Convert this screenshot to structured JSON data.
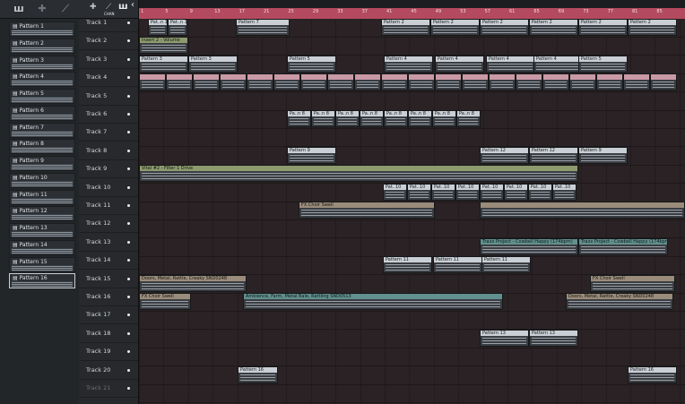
{
  "picker": {
    "icons": [
      "piano-roll-icon",
      "add-icon",
      "wand-icon"
    ],
    "patterns": [
      "Pattern 1",
      "Pattern 2",
      "Pattern 3",
      "Pattern 4",
      "Pattern 5",
      "Pattern 6",
      "Pattern 7",
      "Pattern 8",
      "Pattern 9",
      "Pattern 10",
      "Pattern 11",
      "Pattern 12",
      "Pattern 13",
      "Pattern 14",
      "Pattern 15",
      "Pattern 16"
    ],
    "selected": "Pattern 16"
  },
  "toolbar": {
    "label_a": "CHAN",
    "back_glyph": "‹"
  },
  "ruler": {
    "bars": [
      "1",
      "5",
      "9",
      "13",
      "17",
      "21",
      "25",
      "29",
      "33",
      "37",
      "41",
      "45",
      "49",
      "53",
      "57",
      "61",
      "65",
      "69",
      "73",
      "77",
      "81",
      "85"
    ]
  },
  "tracks": [
    "Track 1",
    "Track 2",
    "Track 3",
    "Track 4",
    "Track 5",
    "Track 6",
    "Track 7",
    "Track 8",
    "Track 9",
    "Track 10",
    "Track 11",
    "Track 12",
    "Track 13",
    "Track 14",
    "Track 15",
    "Track 16",
    "Track 17",
    "Track 18",
    "Track 19",
    "Track 20",
    "Track 21"
  ],
  "clips": {
    "t1": [
      "Pat..n 1",
      "Pat..n 1",
      "Pattern 7",
      "Pattern 2",
      "Pattern 2",
      "Pattern 2",
      "Pattern 2",
      "Pattern 2",
      "Pattern 2"
    ],
    "t2": "Insert 2 - Volume",
    "t3": [
      "Pattern 3",
      "Pattern 3",
      "Pattern 5",
      "Pattern 4",
      "Pattern 4",
      "Pattern 4",
      "Pattern 4",
      "Pattern 5"
    ],
    "t5": [],
    "t6": [
      "Pa..n 8",
      "Pa..n 8",
      "Pa..n 8",
      "Pa..n 8",
      "Pa..n 8",
      "Pa..n 8",
      "Pa..n 8",
      "Pa..n 8"
    ],
    "t8": [
      "Pattern 9",
      "Pattern 12",
      "Pattern 12",
      "Pattern 9"
    ],
    "t9": "Vital #2 - Filter 1 Drive",
    "t10": [
      "Pat..10",
      "Pat..10",
      "Pat..10",
      "Pat..10",
      "Pat..10",
      "Pat..10",
      "Pat..10",
      "Pat..10"
    ],
    "t11": "FX Choir Swell",
    "t13": [
      "Traxx Project - Cowbell Happy (174bpm)",
      "Traxx Project - Cowbell Happy (174bpm)"
    ],
    "t14": [
      "Pattern 11",
      "Pattern 11",
      "Pattern 11"
    ],
    "t15": [
      "Doors, Metal, Rattle, Creaky SND0248",
      "FX Choir Swell"
    ],
    "t16": [
      "FX Choir Swell",
      "Ambience, Farm, Metal Bale, Rattling SND0513",
      "Doors, Metal, Rattle, Creaky SND0248"
    ],
    "t18": [
      "Pattern 13",
      "Pattern 13"
    ],
    "t20": [
      "Pattern 16",
      "Pattern 16"
    ]
  }
}
